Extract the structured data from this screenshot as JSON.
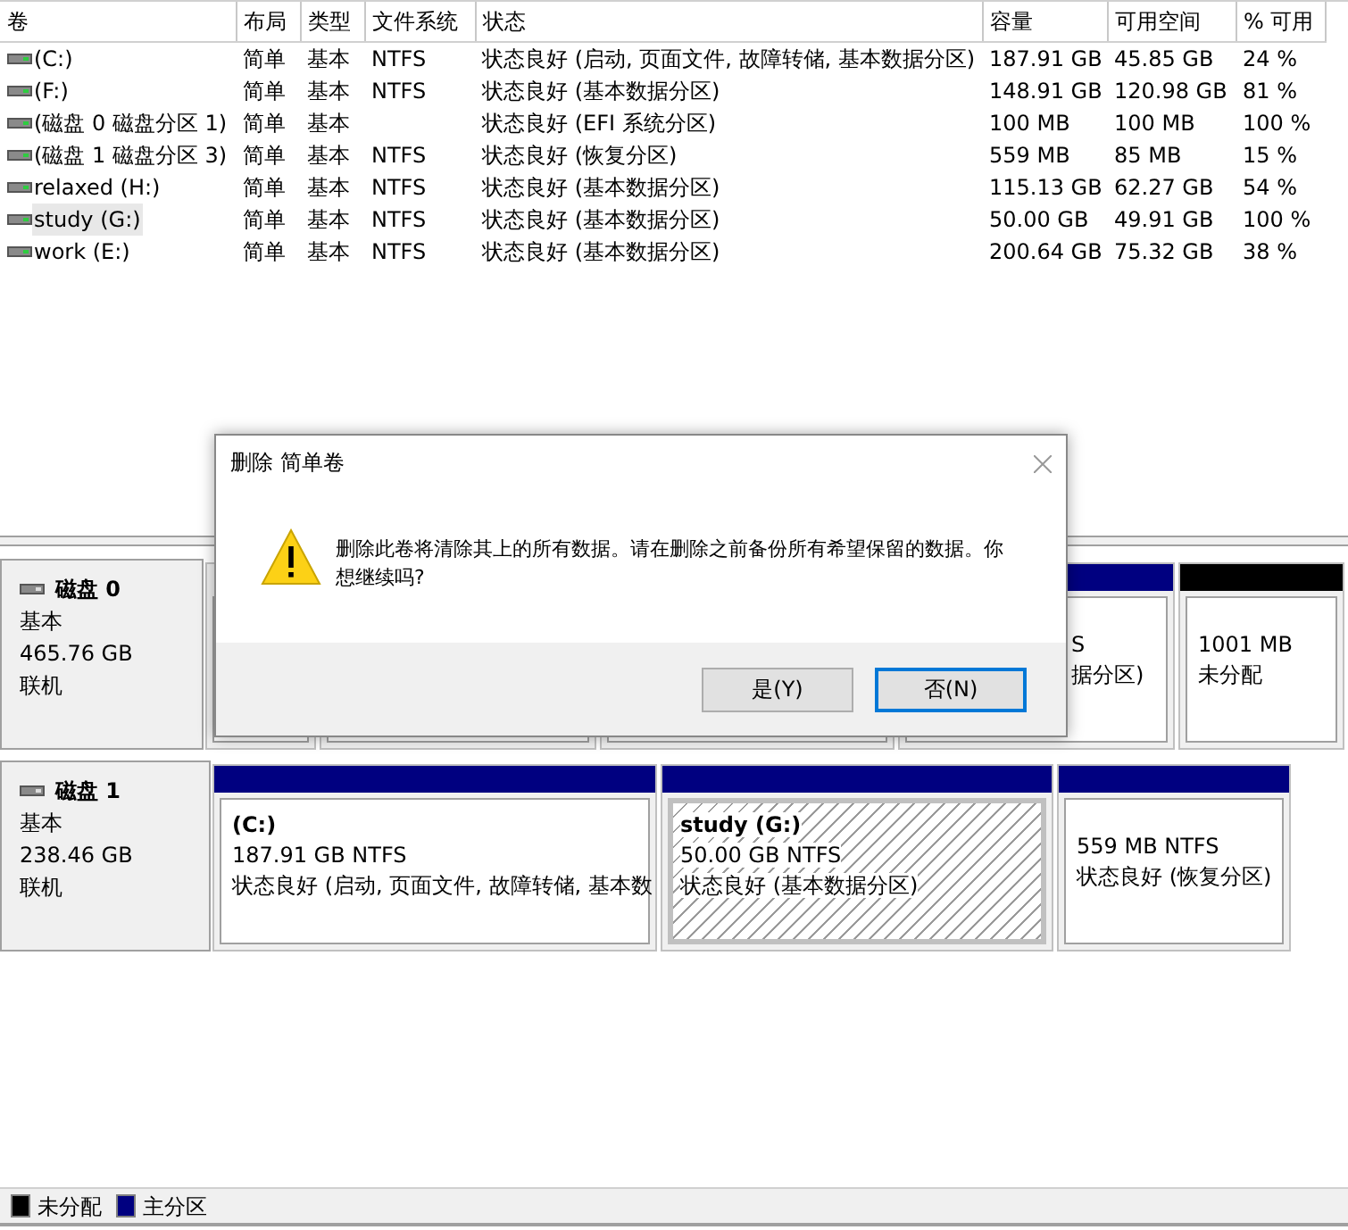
{
  "volume_table": {
    "columns": [
      "卷",
      "布局",
      "类型",
      "文件系统",
      "状态",
      "容量",
      "可用空间",
      "% 可用"
    ],
    "rows": [
      {
        "selected": false,
        "cells": [
          " (C:)",
          "简单",
          "基本",
          "NTFS",
          "状态良好 (启动, 页面文件, 故障转储, 基本数据分区)",
          "187.91 GB",
          "45.85 GB",
          "24 %"
        ]
      },
      {
        "selected": false,
        "cells": [
          " (F:)",
          "简单",
          "基本",
          "NTFS",
          "状态良好 (基本数据分区)",
          "148.91 GB",
          "120.98 GB",
          "81 %"
        ]
      },
      {
        "selected": false,
        "cells": [
          "(磁盘 0 磁盘分区 1)",
          "简单",
          "基本",
          null,
          "状态良好 (EFI 系统分区)",
          "100 MB",
          "100 MB",
          "100 %"
        ]
      },
      {
        "selected": false,
        "cells": [
          "(磁盘 1 磁盘分区 3)",
          "简单",
          "基本",
          "NTFS",
          "状态良好 (恢复分区)",
          "559 MB",
          "85 MB",
          "15 %"
        ]
      },
      {
        "selected": false,
        "cells": [
          "relaxed (H:)",
          "简单",
          "基本",
          "NTFS",
          "状态良好 (基本数据分区)",
          "115.13 GB",
          "62.27 GB",
          "54 %"
        ]
      },
      {
        "selected": true,
        "cells": [
          "study (G:)",
          "简单",
          "基本",
          "NTFS",
          "状态良好 (基本数据分区)",
          "50.00 GB",
          "49.91 GB",
          "100 %"
        ]
      },
      {
        "selected": false,
        "cells": [
          "work (E:)",
          "简单",
          "基本",
          "NTFS",
          "状态良好 (基本数据分区)",
          "200.64 GB",
          "75.32 GB",
          "38 %"
        ]
      }
    ]
  },
  "disks": [
    {
      "name": "磁盘 0",
      "type": "基本",
      "size": "465.76 GB",
      "status": "联机",
      "partitions": [
        {
          "selected": false
        },
        {
          "selected": false
        },
        {
          "selected": false
        },
        {
          "kind": "primary",
          "selected": false,
          "size": "S",
          "status": "据分区)"
        },
        {
          "kind": "unallocated",
          "selected": false,
          "size": "1001 MB",
          "status": "未分配"
        }
      ]
    },
    {
      "name": "磁盘 1",
      "type": "基本",
      "size": "238.46 GB",
      "status": "联机",
      "partitions": [
        {
          "kind": "primary",
          "selected": false,
          "name": " (C:)",
          "size": "187.91 GB NTFS",
          "status": "状态良好 (启动, 页面文件, 故障转储, 基本数"
        },
        {
          "kind": "primary",
          "selected": true,
          "name": "study  (G:)",
          "size": "50.00 GB NTFS",
          "status": "状态良好 (基本数据分区)"
        },
        {
          "kind": "primary",
          "selected": false,
          "size": "559 MB NTFS",
          "status": "状态良好 (恢复分区)"
        }
      ]
    }
  ],
  "legend": [
    {
      "label": "未分配",
      "color": "#000000"
    },
    {
      "label": "主分区",
      "color": "#000080"
    }
  ],
  "dialog": {
    "title": "删除 简单卷",
    "message": "删除此卷将清除其上的所有数据。请在删除之前备份所有希望保留的数据。你想继续吗?",
    "buttons": [
      {
        "label": "是(Y)",
        "focused": false
      },
      {
        "label": "否(N)",
        "focused": true
      }
    ]
  }
}
